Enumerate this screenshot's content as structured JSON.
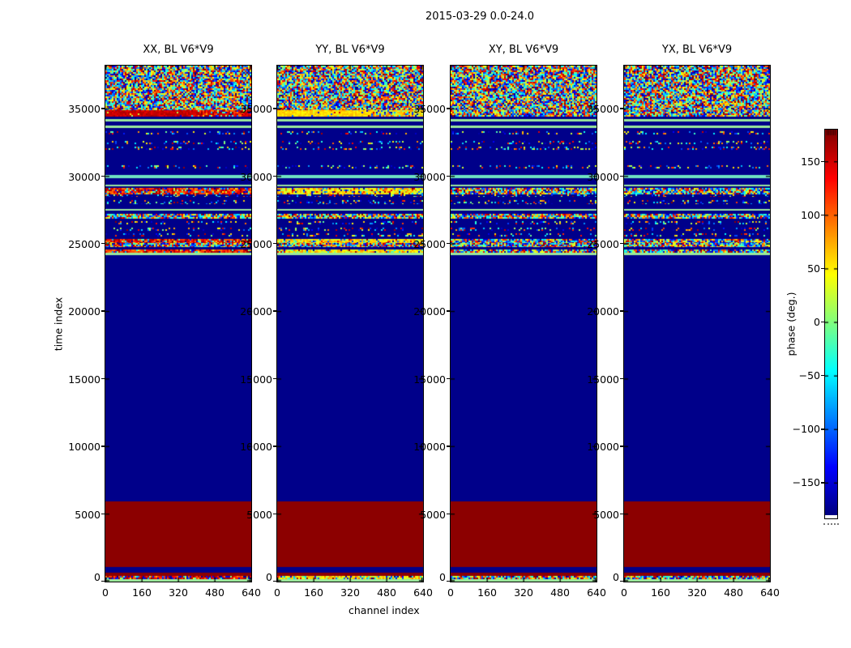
{
  "figure": {
    "title": "2015-03-29 0.0-24.0",
    "xlabel": "channel index",
    "ylabel": "time index",
    "background": "#ffffff"
  },
  "panels": [
    {
      "title": "XX, BL V6*V9",
      "style": "red"
    },
    {
      "title": "YY, BL V6*V9",
      "style": "yellow"
    },
    {
      "title": "XY, BL V6*V9",
      "style": "mixed"
    },
    {
      "title": "YX, BL V6*V9",
      "style": "mixed"
    }
  ],
  "axes": {
    "x_tick_labels": [
      "0",
      "160",
      "320",
      "480",
      "640"
    ],
    "x_tick_values": [
      0,
      160,
      320,
      480,
      640
    ],
    "y_tick_labels": [
      "0",
      "5000",
      "10000",
      "15000",
      "20000",
      "25000",
      "30000",
      "35000"
    ],
    "y_tick_values": [
      0,
      5000,
      10000,
      15000,
      20000,
      25000,
      30000,
      35000
    ],
    "x_range": [
      0,
      640
    ],
    "y_range": [
      0,
      38200
    ]
  },
  "colorbar": {
    "label": "phase (deg.)",
    "tick_labels": [
      "150",
      "100",
      "50",
      "0",
      "−50",
      "−100",
      "−150"
    ],
    "tick_values": [
      150,
      100,
      50,
      0,
      -50,
      -100,
      -150
    ],
    "range": [
      -180,
      180
    ],
    "colormap": "jet"
  },
  "palette": {
    "blue": "#00008a",
    "darkred": "#8c0000",
    "paleGreen": "#9ce89c",
    "cyanGreen": "#6fe2c2",
    "red_band": "#d42000",
    "yellow_band": "#f5d832"
  },
  "heatmap_bands": [
    {
      "y0": 0,
      "y1": 55,
      "type": "noise"
    },
    {
      "y0": 55,
      "y1": 63,
      "type": "special"
    },
    {
      "y0": 63,
      "y1": 66,
      "type": "solid",
      "c": "blue"
    },
    {
      "y0": 66,
      "y1": 69,
      "type": "line",
      "c": "paleGreen"
    },
    {
      "y0": 69,
      "y1": 74,
      "type": "solid",
      "c": "blue"
    },
    {
      "y0": 74,
      "y1": 77,
      "type": "line",
      "c": "paleGreen"
    },
    {
      "y0": 77,
      "y1": 81,
      "type": "solid",
      "c": "blue"
    },
    {
      "y0": 81,
      "y1": 85,
      "type": "sparse"
    },
    {
      "y0": 85,
      "y1": 93,
      "type": "solid",
      "c": "blue"
    },
    {
      "y0": 93,
      "y1": 97,
      "type": "sparse"
    },
    {
      "y0": 97,
      "y1": 100,
      "type": "solid",
      "c": "blue"
    },
    {
      "y0": 100,
      "y1": 104,
      "type": "sparse"
    },
    {
      "y0": 104,
      "y1": 123,
      "type": "solid",
      "c": "blue"
    },
    {
      "y0": 123,
      "y1": 127,
      "type": "sparse"
    },
    {
      "y0": 127,
      "y1": 135,
      "type": "solid",
      "c": "blue"
    },
    {
      "y0": 135,
      "y1": 139,
      "type": "line",
      "c": "cyanGreen"
    },
    {
      "y0": 139,
      "y1": 147,
      "type": "solid",
      "c": "blue"
    },
    {
      "y0": 147,
      "y1": 149,
      "type": "line",
      "c": "paleGreen"
    },
    {
      "y0": 149,
      "y1": 151,
      "type": "solid",
      "c": "blue"
    },
    {
      "y0": 151,
      "y1": 159,
      "type": "dense_warm"
    },
    {
      "y0": 159,
      "y1": 162,
      "type": "sparse"
    },
    {
      "y0": 162,
      "y1": 166,
      "type": "solid",
      "c": "blue"
    },
    {
      "y0": 166,
      "y1": 171,
      "type": "sparse"
    },
    {
      "y0": 171,
      "y1": 177,
      "type": "solid",
      "c": "blue"
    },
    {
      "y0": 177,
      "y1": 179,
      "type": "line",
      "c": "paleGreen"
    },
    {
      "y0": 179,
      "y1": 183,
      "type": "solid",
      "c": "blue"
    },
    {
      "y0": 183,
      "y1": 189,
      "type": "dense_multi"
    },
    {
      "y0": 189,
      "y1": 192,
      "type": "solid",
      "c": "blue"
    },
    {
      "y0": 192,
      "y1": 196,
      "type": "sparse"
    },
    {
      "y0": 196,
      "y1": 200,
      "type": "solid",
      "c": "blue"
    },
    {
      "y0": 200,
      "y1": 204,
      "type": "sparse"
    },
    {
      "y0": 204,
      "y1": 207,
      "type": "solid",
      "c": "blue"
    },
    {
      "y0": 207,
      "y1": 211,
      "type": "sparse"
    },
    {
      "y0": 211,
      "y1": 214,
      "type": "solid",
      "c": "blue"
    },
    {
      "y0": 214,
      "y1": 219,
      "type": "dense_warm"
    },
    {
      "y0": 219,
      "y1": 224,
      "type": "dense_multi"
    },
    {
      "y0": 224,
      "y1": 227,
      "type": "solid",
      "c": "blue"
    },
    {
      "y0": 227,
      "y1": 231,
      "type": "dense_warm"
    },
    {
      "y0": 231,
      "y1": 234,
      "type": "line",
      "c": "paleGreen"
    },
    {
      "y0": 234,
      "y1": 538,
      "type": "solid",
      "c": "blue"
    },
    {
      "y0": 538,
      "y1": 619,
      "type": "solid",
      "c": "darkred"
    },
    {
      "y0": 619,
      "y1": 626,
      "type": "solid",
      "c": "blue"
    },
    {
      "y0": 626,
      "y1": 630,
      "type": "solid",
      "c": "darkred"
    },
    {
      "y0": 630,
      "y1": 634,
      "type": "noise_row"
    },
    {
      "y0": 634,
      "y1": 637,
      "type": "line",
      "c": "paleGreen"
    }
  ],
  "chart_data": {
    "type": "heatmap",
    "title": "2015-03-29 0.0-24.0",
    "xlabel": "channel index",
    "ylabel": "time index",
    "colorbar_label": "phase (deg.)",
    "colormap": "jet",
    "x_range": [
      0,
      640
    ],
    "y_range": [
      0,
      38200
    ],
    "z_range": [
      -180,
      180
    ],
    "z_unit": "deg",
    "panels": [
      "XX, BL V6*V9",
      "YY, BL V6*V9",
      "XY, BL V6*V9",
      "YX, BL V6*V9"
    ],
    "time_bands": [
      {
        "t": [
          0,
          180
        ],
        "value": "pale green row (~ -30 deg), all panels"
      },
      {
        "t": [
          180,
          420
        ],
        "value": "noisy row: XX red-biased, YY yellow-biased, XY/YX mixed colors"
      },
      {
        "t": [
          420,
          660
        ],
        "value": "solid ~ +180 deg (dark red)"
      },
      {
        "t": [
          660,
          1080
        ],
        "value": "solid ~ -180 deg (dark blue)"
      },
      {
        "t": [
          1080,
          5940
        ],
        "value": "solid ~ +180 deg (dark red)"
      },
      {
        "t": [
          5940,
          24180
        ],
        "value": "solid ~ -180 deg (dark blue)"
      },
      {
        "t": [
          24180,
          24360
        ],
        "value": "pale green line"
      },
      {
        "t": [
          24360,
          29160
        ],
        "value": "dark blue with dense noisy bands near 24500, 25100, 26900-27200, 28700-29100 (XX red-dominant, YY yellow-dominant, XY/YX mixed) and sparse dotted rows"
      },
      {
        "t": [
          29160,
          30120
        ],
        "value": "dark blue with sparse dotted rows and pale green / cyan lines"
      },
      {
        "t": [
          30120,
          34440
        ],
        "value": "dark blue with sparse dotted rows at ~30700, ~32000, ~32500, ~33100"
      },
      {
        "t": [
          34440,
          34920
        ],
        "value": "calibration band: XX solid red (~ +160 deg), YY solid yellow (~ +55 deg), XY/YX random noise"
      },
      {
        "t": [
          34920,
          38200
        ],
        "value": "random phase noise spanning full ±180 deg, all panels"
      }
    ]
  }
}
